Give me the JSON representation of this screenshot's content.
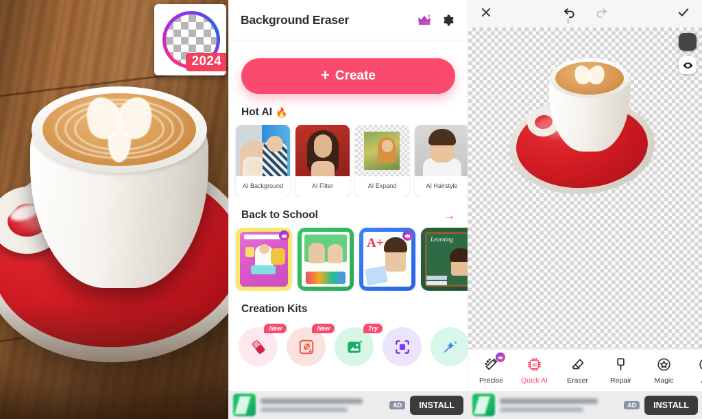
{
  "photo_pane": {
    "name": "coffee-cup-photo",
    "app_icon": {
      "year_badge": "2024",
      "alt": "background-eraser-app-icon"
    }
  },
  "app": {
    "header": {
      "title": "Background Eraser",
      "premium_icon": "crown-icon",
      "settings_icon": "gear-icon"
    },
    "create_button": {
      "plus": "+",
      "label": "Create"
    },
    "sections": [
      {
        "id": "hot-ai",
        "title": "Hot AI",
        "emoji": "🔥",
        "has_arrow": false,
        "items": [
          {
            "label": "AI Background"
          },
          {
            "label": "AI Filter"
          },
          {
            "label": "AI Expand"
          },
          {
            "label": "AI Hairstyle"
          }
        ]
      },
      {
        "id": "back-to-school",
        "title": "Back to School",
        "emoji": "",
        "has_arrow": true,
        "arrow": "→",
        "items": [
          {
            "label": "",
            "premium": true
          },
          {
            "label": "",
            "premium": false
          },
          {
            "label": "",
            "premium": true
          },
          {
            "label": "",
            "premium": false
          }
        ]
      },
      {
        "id": "creation-kits",
        "title": "Creation Kits",
        "emoji": "",
        "has_arrow": false,
        "items": [
          {
            "label": "",
            "tag": "New",
            "icon": "eraser-icon"
          },
          {
            "label": "",
            "tag": "New",
            "icon": "ai-resize-icon"
          },
          {
            "label": "",
            "tag": "Try",
            "icon": "photo-enhance-icon"
          },
          {
            "label": "",
            "tag": "",
            "icon": "crop-focus-icon"
          },
          {
            "label": "",
            "tag": "",
            "icon": "magic-wand-icon"
          }
        ]
      }
    ]
  },
  "ad": {
    "flag": "AD",
    "install_label": "INSTALL",
    "title": "",
    "subtitle": ""
  },
  "editor": {
    "top_bar": {
      "close_icon": "close-icon",
      "undo_icon": "undo-icon",
      "undo_count": "1",
      "redo_icon": "redo-icon",
      "confirm_icon": "check-icon"
    },
    "canvas": {
      "background": "transparent-checkerboard",
      "color_swatch": "#454545",
      "preview_icon": "eye-icon",
      "delete_icon": "trash-icon"
    },
    "tools": [
      {
        "label": "Precise",
        "icon": "magic-brush-icon",
        "active": false,
        "premium": true
      },
      {
        "label": "Quick AI",
        "icon": "ai-chip-icon",
        "active": true,
        "premium": false
      },
      {
        "label": "Eraser",
        "icon": "eraser-icon",
        "active": false,
        "premium": false
      },
      {
        "label": "Repair",
        "icon": "repair-pen-icon",
        "active": false,
        "premium": false
      },
      {
        "label": "Magic",
        "icon": "star-badge-icon",
        "active": false,
        "premium": false
      },
      {
        "label": "Au",
        "icon": "star-badge-icon",
        "active": false,
        "premium": false
      }
    ]
  },
  "colors": {
    "accent_pink": "#fa4a6e",
    "premium_purple": "#7c3aed",
    "text_dark": "#2b2b33",
    "ad_bg": "#ececec"
  }
}
